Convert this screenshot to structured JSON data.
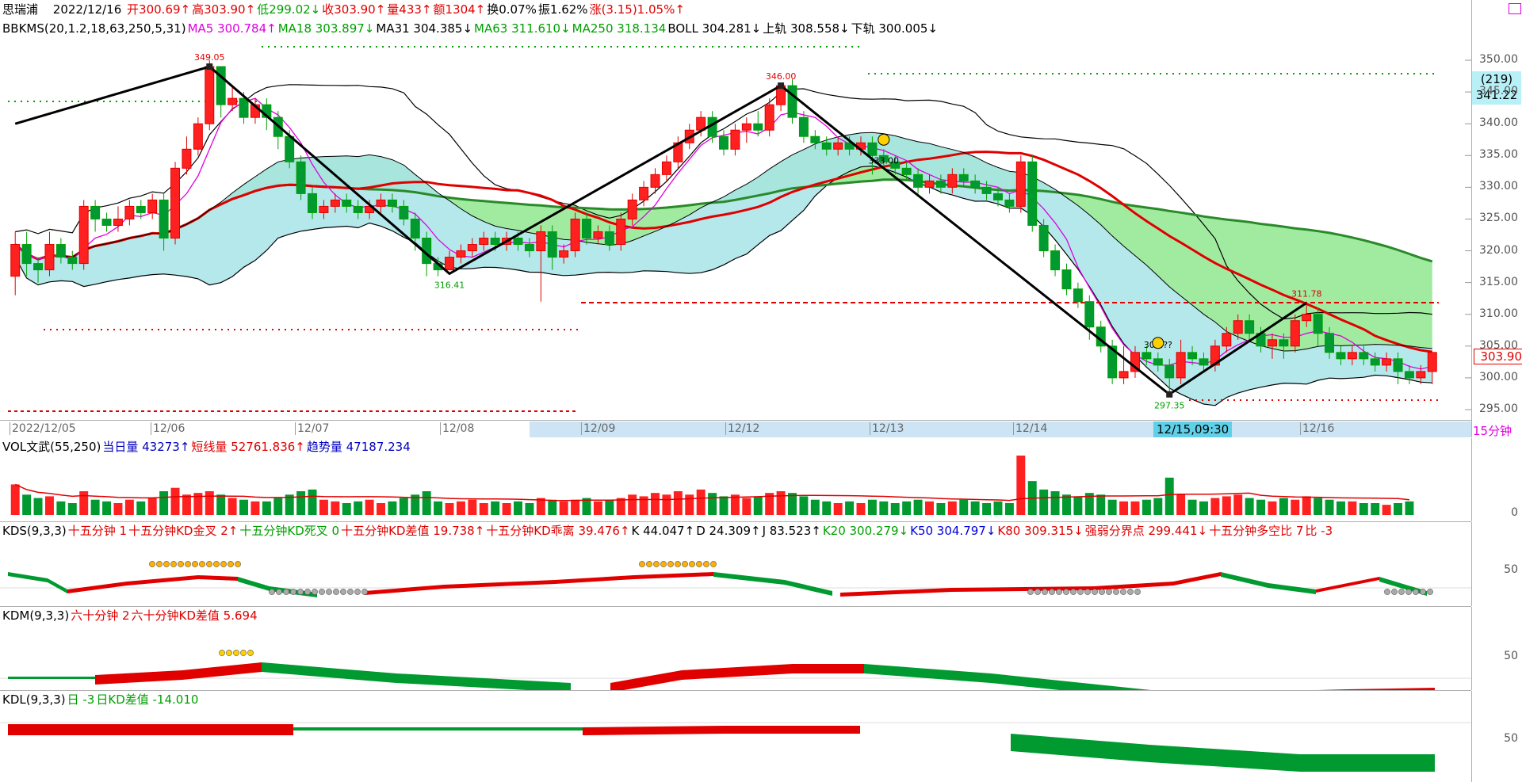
{
  "header": {
    "name": "思瑞浦",
    "date": "2022/12/16",
    "items": [
      {
        "text": "开300.69↑",
        "color": "#e00000"
      },
      {
        "text": "高303.90↑",
        "color": "#e00000"
      },
      {
        "text": "低299.02↓",
        "color": "#00a000"
      },
      {
        "text": "收303.90↑",
        "color": "#e00000"
      },
      {
        "text": "量433↑",
        "color": "#e00000"
      },
      {
        "text": "额1304↑",
        "color": "#e00000"
      },
      {
        "text": "换0.07%",
        "color": "#000000"
      },
      {
        "text": "振1.62%",
        "color": "#000000"
      },
      {
        "text": "涨(3.15)1.05%↑",
        "color": "#e00000"
      }
    ]
  },
  "main_legend": [
    {
      "text": "BBKMS(20,1.2,18,63,250,5,31)",
      "color": "#000000"
    },
    {
      "text": "MA5 300.784↑",
      "color": "#e000e0"
    },
    {
      "text": "MA18 303.897↓",
      "color": "#00a000"
    },
    {
      "text": "MA31 304.385↓",
      "color": "#000000"
    },
    {
      "text": "MA63 311.610↓",
      "color": "#00a000"
    },
    {
      "text": "MA250 318.134",
      "color": "#00a000"
    },
    {
      "text": "BOLL 304.281↓",
      "color": "#000000"
    },
    {
      "text": "上轨 308.558↓",
      "color": "#000000"
    },
    {
      "text": "下轨 300.005↓",
      "color": "#000000"
    }
  ],
  "price_axis": {
    "ticks": [
      "350.00",
      "345.00",
      "340.00",
      "335.00",
      "330.00",
      "325.00",
      "320.00",
      "315.00",
      "310.00",
      "305.00",
      "300.00",
      "295.00"
    ],
    "tick_values": [
      350,
      345,
      340,
      335,
      330,
      325,
      320,
      315,
      310,
      305,
      300,
      295
    ],
    "cursor_count": "(219)",
    "cursor_price": "341.22",
    "last_price": "303.90"
  },
  "date_axis": {
    "labels": [
      "2022/12/05",
      "12/06",
      "12/07",
      "12/08",
      "12/09",
      "12/12",
      "12/13",
      "12/14",
      "12/16"
    ],
    "cursor_label": "12/15,09:30",
    "period": "15分钟"
  },
  "annotations": {
    "high1": "349.05",
    "low1": "316.41",
    "high2": "346.00",
    "mid1": "333.00",
    "low2": "297.35",
    "mid2": "305.??",
    "high3": "311.78"
  },
  "vol_legend": [
    {
      "text": "VOL文武(55,250)",
      "color": "#000000"
    },
    {
      "text": "当日量 43273↑",
      "color": "#0000c0"
    },
    {
      "text": "短线量 52761.836↑",
      "color": "#e00000"
    },
    {
      "text": "趋势量 47187.234",
      "color": "#0000c0"
    }
  ],
  "vol_axis": {
    "zero": "0"
  },
  "kds_legend": [
    {
      "text": "KDS(9,3,3)",
      "color": "#000000"
    },
    {
      "text": "十五分钟 1",
      "color": "#e00000"
    },
    {
      "text": "十五分钟KD金叉 2↑",
      "color": "#e00000"
    },
    {
      "text": "十五分钟KD死叉 0",
      "color": "#00a000"
    },
    {
      "text": "十五分钟KD差值 19.738↑",
      "color": "#e00000"
    },
    {
      "text": "十五分钟KD乖离 39.476↑",
      "color": "#e00000"
    },
    {
      "text": "K 44.047↑",
      "color": "#000000"
    },
    {
      "text": "D 24.309↑",
      "color": "#000000"
    },
    {
      "text": "J 83.523↑",
      "color": "#000000"
    },
    {
      "text": "K20 300.279↓",
      "color": "#00a000"
    },
    {
      "text": "K50 304.797↓",
      "color": "#0000e0"
    },
    {
      "text": "K80 309.315↓",
      "color": "#e00000"
    },
    {
      "text": "强弱分界点 299.441↓",
      "color": "#e00000"
    },
    {
      "text": "十五分钟多空比 7",
      "color": "#e00000"
    },
    {
      "text": "比 -3",
      "color": "#e00000"
    }
  ],
  "kdm_legend": [
    {
      "text": "KDM(9,3,3)",
      "color": "#000000"
    },
    {
      "text": "六十分钟 2",
      "color": "#e00000"
    },
    {
      "text": "六十分钟KD差值 5.694",
      "color": "#e00000"
    }
  ],
  "kdl_legend": [
    {
      "text": "KDL(9,3,3)",
      "color": "#000000"
    },
    {
      "text": "日 -3",
      "color": "#00a000"
    },
    {
      "text": "日KD差值 -14.010",
      "color": "#00a000"
    }
  ],
  "osc_axis": {
    "level": "50"
  },
  "chart_data": {
    "type": "candlestick",
    "ylim": [
      294,
      352
    ],
    "candles": [
      [
        316,
        321,
        313,
        323
      ],
      [
        321,
        318,
        316,
        323
      ],
      [
        318,
        317,
        315,
        319
      ],
      [
        317,
        321,
        316,
        323
      ],
      [
        321,
        319,
        318,
        322
      ],
      [
        319,
        318,
        317,
        320
      ],
      [
        318,
        327,
        317,
        328
      ],
      [
        327,
        325,
        323,
        328
      ],
      [
        325,
        324,
        323,
        326
      ],
      [
        324,
        325,
        323,
        327
      ],
      [
        325,
        327,
        324,
        328
      ],
      [
        327,
        326,
        325,
        328
      ],
      [
        326,
        328,
        325,
        329
      ],
      [
        328,
        322,
        320,
        329
      ],
      [
        322,
        333,
        321,
        334
      ],
      [
        333,
        336,
        332,
        338
      ],
      [
        336,
        340,
        335,
        341
      ],
      [
        340,
        349,
        339,
        350
      ],
      [
        349,
        343,
        341,
        349
      ],
      [
        343,
        344,
        342,
        346
      ],
      [
        344,
        341,
        340,
        345
      ],
      [
        341,
        343,
        340,
        344
      ],
      [
        343,
        341,
        339,
        344
      ],
      [
        341,
        338,
        336,
        342
      ],
      [
        338,
        334,
        333,
        339
      ],
      [
        334,
        329,
        328,
        335
      ],
      [
        329,
        326,
        325,
        330
      ],
      [
        326,
        327,
        325,
        328
      ],
      [
        327,
        328,
        326,
        329
      ],
      [
        328,
        327,
        326,
        329
      ],
      [
        327,
        326,
        325,
        328
      ],
      [
        326,
        327,
        325,
        328
      ],
      [
        327,
        328,
        326,
        329
      ],
      [
        328,
        327,
        326,
        329
      ],
      [
        327,
        325,
        324,
        328
      ],
      [
        325,
        322,
        320,
        326
      ],
      [
        322,
        318,
        316,
        323
      ],
      [
        318,
        317,
        316,
        319
      ],
      [
        317,
        319,
        317,
        320
      ],
      [
        319,
        320,
        318,
        321
      ],
      [
        320,
        321,
        319,
        322
      ],
      [
        321,
        322,
        320,
        323
      ],
      [
        322,
        321,
        320,
        323
      ],
      [
        321,
        322,
        320,
        323
      ],
      [
        322,
        321,
        320,
        323
      ],
      [
        321,
        320,
        319,
        322
      ],
      [
        320,
        323,
        312,
        324
      ],
      [
        323,
        319,
        317,
        324
      ],
      [
        319,
        320,
        318,
        321
      ],
      [
        320,
        325,
        319,
        326
      ],
      [
        325,
        322,
        321,
        326
      ],
      [
        322,
        323,
        321,
        324
      ],
      [
        323,
        321,
        320,
        324
      ],
      [
        321,
        325,
        320,
        326
      ],
      [
        325,
        328,
        324,
        329
      ],
      [
        328,
        330,
        327,
        331
      ],
      [
        330,
        332,
        329,
        333
      ],
      [
        332,
        334,
        331,
        335
      ],
      [
        334,
        337,
        333,
        338
      ],
      [
        337,
        339,
        336,
        340
      ],
      [
        339,
        341,
        338,
        342
      ],
      [
        341,
        338,
        337,
        342
      ],
      [
        338,
        336,
        335,
        339
      ],
      [
        336,
        339,
        335,
        340
      ],
      [
        339,
        340,
        337,
        341
      ],
      [
        340,
        339,
        338,
        342
      ],
      [
        339,
        343,
        338,
        344
      ],
      [
        343,
        346,
        342,
        346
      ],
      [
        346,
        341,
        340,
        347
      ],
      [
        341,
        338,
        337,
        342
      ],
      [
        338,
        337,
        336,
        339
      ],
      [
        337,
        336,
        335,
        338
      ],
      [
        336,
        337,
        335,
        338
      ],
      [
        337,
        336,
        335,
        338
      ],
      [
        336,
        337,
        335,
        338
      ],
      [
        337,
        335,
        332,
        338
      ],
      [
        335,
        334,
        333,
        336
      ],
      [
        334,
        333,
        332,
        335
      ],
      [
        333,
        332,
        331,
        334
      ],
      [
        332,
        330,
        329,
        333
      ],
      [
        330,
        331,
        329,
        332
      ],
      [
        331,
        330,
        329,
        332
      ],
      [
        330,
        332,
        329,
        333
      ],
      [
        332,
        331,
        330,
        333
      ],
      [
        331,
        330,
        329,
        332
      ],
      [
        330,
        329,
        328,
        331
      ],
      [
        329,
        328,
        327,
        330
      ],
      [
        328,
        327,
        326,
        329
      ],
      [
        327,
        334,
        326,
        335
      ],
      [
        334,
        324,
        323,
        335
      ],
      [
        324,
        320,
        319,
        325
      ],
      [
        320,
        317,
        316,
        321
      ],
      [
        317,
        314,
        313,
        318
      ],
      [
        314,
        312,
        311,
        315
      ],
      [
        312,
        308,
        306,
        313
      ],
      [
        308,
        305,
        304,
        309
      ],
      [
        305,
        300,
        299,
        306
      ],
      [
        300,
        301,
        299,
        305
      ],
      [
        301,
        304,
        300,
        305
      ],
      [
        304,
        303,
        302,
        305
      ],
      [
        303,
        302,
        301,
        304
      ],
      [
        302,
        300,
        297,
        303
      ],
      [
        300,
        304,
        299,
        306
      ],
      [
        304,
        303,
        302,
        305
      ],
      [
        303,
        302,
        301,
        304
      ],
      [
        302,
        305,
        301,
        306
      ],
      [
        305,
        307,
        304,
        308
      ],
      [
        307,
        309,
        306,
        310
      ],
      [
        309,
        307,
        306,
        310
      ],
      [
        307,
        305,
        304,
        308
      ],
      [
        305,
        306,
        303,
        307
      ],
      [
        306,
        305,
        303,
        307
      ],
      [
        305,
        309,
        304,
        310
      ],
      [
        309,
        310,
        308,
        312
      ],
      [
        310,
        307,
        305,
        311
      ],
      [
        307,
        304,
        303,
        308
      ],
      [
        304,
        303,
        302,
        305
      ],
      [
        303,
        304,
        302,
        305
      ],
      [
        304,
        303,
        302,
        305
      ],
      [
        303,
        302,
        301,
        304
      ],
      [
        302,
        303,
        301,
        304
      ],
      [
        303,
        301,
        299,
        304
      ],
      [
        301,
        300,
        299,
        302
      ],
      [
        300,
        301,
        299,
        302
      ],
      [
        301,
        304,
        299,
        304
      ]
    ],
    "volumes": [
      18,
      12,
      10,
      11,
      8,
      7,
      14,
      9,
      8,
      7,
      9,
      8,
      10,
      14,
      16,
      12,
      13,
      14,
      12,
      10,
      9,
      8,
      8,
      10,
      12,
      14,
      15,
      9,
      8,
      7,
      8,
      9,
      7,
      8,
      10,
      12,
      14,
      8,
      7,
      8,
      9,
      7,
      8,
      7,
      8,
      7,
      10,
      9,
      8,
      9,
      10,
      8,
      9,
      10,
      12,
      11,
      13,
      12,
      14,
      12,
      15,
      13,
      11,
      12,
      10,
      11,
      13,
      14,
      13,
      11,
      9,
      8,
      7,
      8,
      7,
      9,
      8,
      7,
      8,
      9,
      8,
      7,
      8,
      9,
      8,
      7,
      8,
      7,
      35,
      20,
      15,
      14,
      12,
      11,
      13,
      12,
      9,
      8,
      8,
      9,
      10,
      22,
      12,
      9,
      8,
      10,
      11,
      12,
      10,
      9,
      8,
      10,
      9,
      11,
      10,
      9,
      8,
      8,
      7,
      7,
      6,
      7,
      8
    ]
  }
}
